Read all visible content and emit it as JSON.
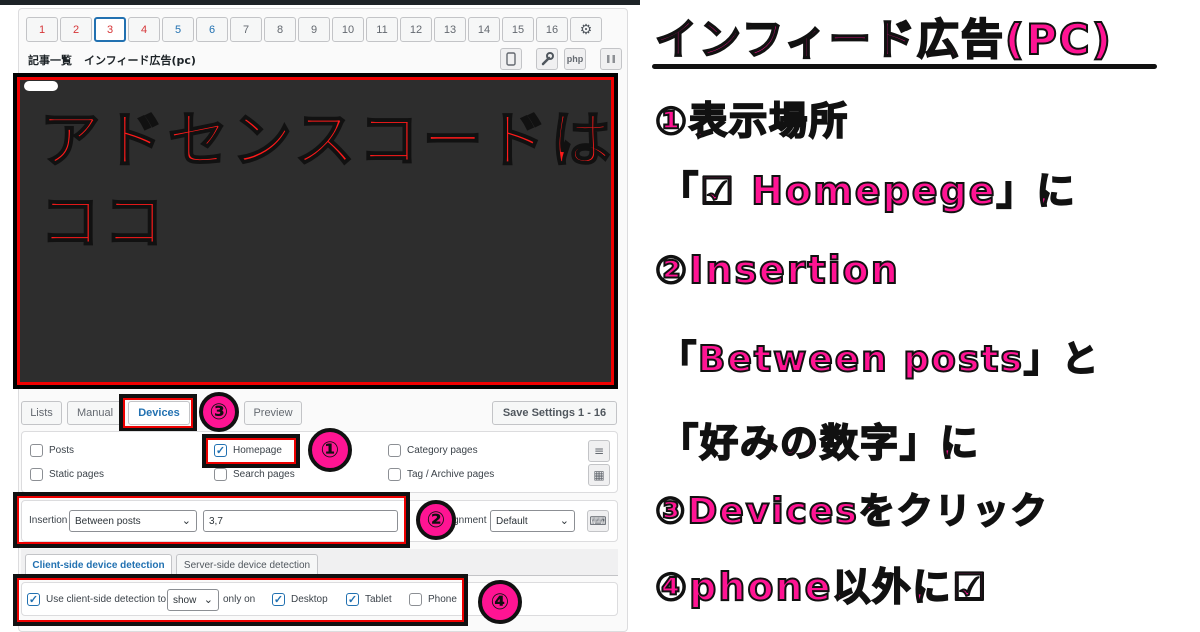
{
  "tabs": [
    "1",
    "2",
    "3",
    "4",
    "5",
    "6",
    "7",
    "8",
    "9",
    "10",
    "11",
    "12",
    "13",
    "14",
    "15",
    "16"
  ],
  "block_title": {
    "label": "記事一覧",
    "name": "インフィード広告(pc)"
  },
  "header_icons": {
    "php": "php"
  },
  "editor": {
    "line1": "アドセンスコードは",
    "line2": "ココ"
  },
  "mode_tabs": {
    "lists": "Lists",
    "manual": "Manual",
    "devices": "Devices",
    "preview": "Preview"
  },
  "save_button": "Save Settings 1 - 16",
  "pages": {
    "posts": "Posts",
    "homepage": "Homepage",
    "category": "Category pages",
    "static": "Static pages",
    "search": "Search pages",
    "tag": "Tag / Archive pages"
  },
  "insertion": {
    "label": "Insertion",
    "value": "Between posts",
    "positions": "3,7",
    "alignment_label": "Alignment",
    "alignment_value": "Default"
  },
  "detection_tabs": {
    "client": "Client-side device detection",
    "server": "Server-side device detection"
  },
  "detection": {
    "use_label": "Use client-side detection to",
    "mode": "show",
    "only_on": "only on",
    "desktop": "Desktop",
    "tablet": "Tablet",
    "phone": "Phone"
  },
  "annotations": {
    "title": "インフィード広告(PC)",
    "step1": "①表示場所",
    "step1b": "「☑ Homepege」に",
    "step2": "②Insertion",
    "step2b": "「Between posts」と",
    "step2c": "「好みの数字」に",
    "step3": "③Devicesをクリック",
    "step4": "④phone以外に☑",
    "c1": "①",
    "c2": "②",
    "c3": "③",
    "c4": "④"
  },
  "colors": {
    "accent": "#2271b1",
    "annotation": "#ff1493",
    "highlight": "#ee0000"
  }
}
